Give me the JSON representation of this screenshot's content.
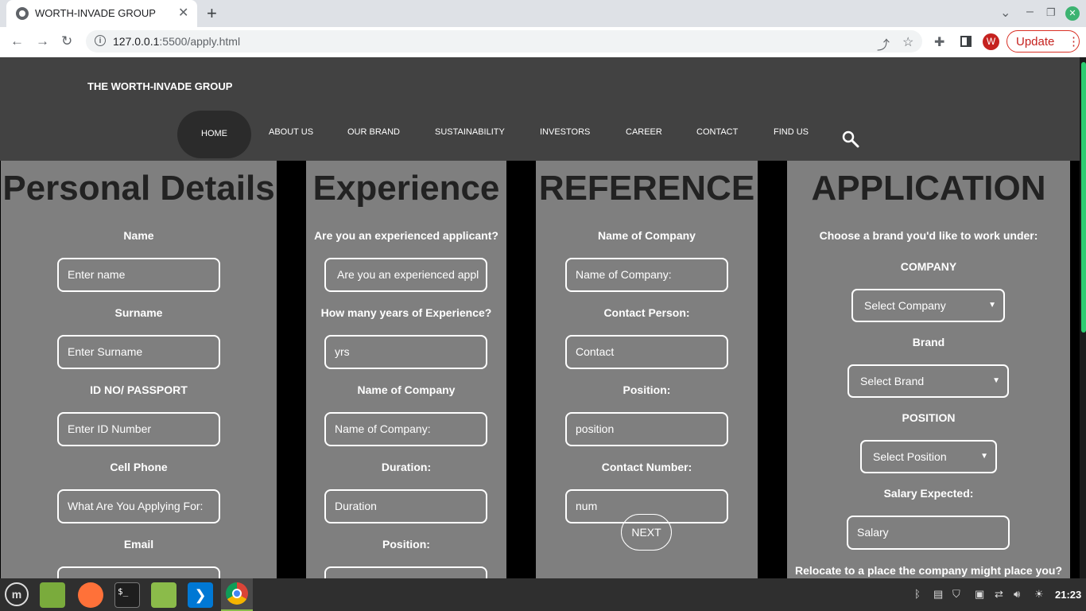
{
  "browser": {
    "tab_title": "WORTH-INVADE GROUP",
    "url_host": "127.0.0.1",
    "url_path": ":5500/apply.html",
    "profile_initial": "W",
    "update_label": "Update"
  },
  "site": {
    "brand": "THE WORTH-INVADE GROUP",
    "nav": [
      "HOME",
      "ABOUT US",
      "OUR BRAND",
      "SUSTAINABILITY",
      "INVESTORS",
      "CAREER",
      "CONTACT",
      "FIND US"
    ]
  },
  "personal": {
    "title": "Personal Details",
    "fields": [
      {
        "label": "Name",
        "placeholder": "Enter name"
      },
      {
        "label": "Surname",
        "placeholder": "Enter Surname"
      },
      {
        "label": "ID NO/ PASSPORT",
        "placeholder": "Enter ID Number"
      },
      {
        "label": "Cell Phone",
        "placeholder": "What Are You Applying For:"
      },
      {
        "label": "Email",
        "placeholder": ""
      }
    ]
  },
  "experience": {
    "title": "Experience",
    "fields": [
      {
        "label": "Are you an experienced applicant?",
        "placeholder": "Are you an experienced appl"
      },
      {
        "label": "How many years of Experience?",
        "placeholder": "yrs"
      },
      {
        "label": "Name of Company",
        "placeholder": "Name of Company:"
      },
      {
        "label": "Duration:",
        "placeholder": "Duration"
      },
      {
        "label": "Position:",
        "placeholder": ""
      }
    ]
  },
  "reference": {
    "title": "REFERENCE",
    "fields": [
      {
        "label": "Name of Company",
        "placeholder": "Name of Company:"
      },
      {
        "label": "Contact Person:",
        "placeholder": "Contact"
      },
      {
        "label": "Position:",
        "placeholder": "position"
      },
      {
        "label": "Contact Number:",
        "placeholder": "num"
      }
    ],
    "next_label": "NEXT"
  },
  "application": {
    "title": "APPLICATION",
    "intro": "Choose a brand you'd like to work under:",
    "company_label": "COMPANY",
    "company_select": "Select Company",
    "brand_label": "Brand",
    "brand_select": "Select Brand",
    "position_label": "POSITION",
    "position_select": "Select Position",
    "salary_label": "Salary Expected:",
    "salary_placeholder": "Salary",
    "relocate_label": "Relocate to a place the company might place you?"
  },
  "taskbar": {
    "clock": "21:23"
  },
  "colors": {
    "header_bg": "#424242",
    "panel_bg": "#7f7f7f",
    "page_bg": "#000000",
    "scroll_accent": "#2ecc71"
  }
}
